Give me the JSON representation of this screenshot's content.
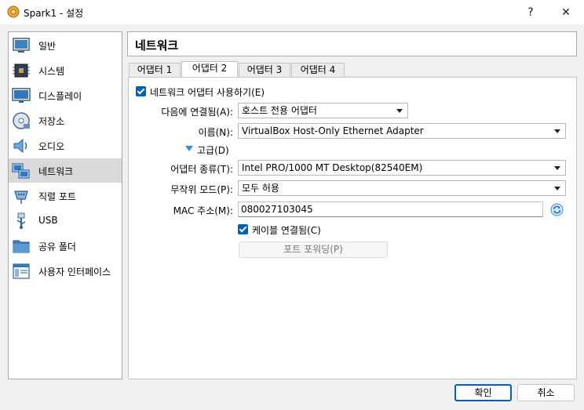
{
  "window": {
    "title": "Spark1 - 설정",
    "help_glyph": "?",
    "close_glyph": "✕"
  },
  "sidebar": {
    "items": [
      {
        "label": "일반",
        "icon": "general-icon"
      },
      {
        "label": "시스템",
        "icon": "system-icon"
      },
      {
        "label": "디스플레이",
        "icon": "display-icon"
      },
      {
        "label": "저장소",
        "icon": "storage-icon"
      },
      {
        "label": "오디오",
        "icon": "audio-icon"
      },
      {
        "label": "네트워크",
        "icon": "network-icon",
        "selected": true
      },
      {
        "label": "직렬 포트",
        "icon": "serial-port-icon"
      },
      {
        "label": "USB",
        "icon": "usb-icon"
      },
      {
        "label": "공유 폴더",
        "icon": "shared-folder-icon"
      },
      {
        "label": "사용자 인터페이스",
        "icon": "user-interface-icon"
      }
    ]
  },
  "page": {
    "title": "네트워크"
  },
  "tabs": [
    {
      "label": "어댑터 1"
    },
    {
      "label": "어댑터 2",
      "active": true
    },
    {
      "label": "어댑터 3"
    },
    {
      "label": "어댑터 4"
    }
  ],
  "adapter": {
    "enable_label": "네트워크 어댑터 사용하기(E)",
    "attached_label": "다음에 연결됨(A):",
    "attached_value": "호스트 전용 어댑터",
    "name_label": "이름(N):",
    "name_value": "VirtualBox Host-Only Ethernet Adapter",
    "advanced_label": "고급(D)",
    "type_label": "어댑터 종류(T):",
    "type_value": "Intel PRO/1000 MT Desktop(82540EM)",
    "promisc_label": "무작위 모드(P):",
    "promisc_value": "모두 허용",
    "mac_label": "MAC 주소(M):",
    "mac_value": "080027103045",
    "cable_label": "케이블 연결됨(C)",
    "port_forwarding_label": "포트 포워딩(P)"
  },
  "buttons": {
    "ok": "확인",
    "cancel": "취소"
  },
  "colors": {
    "accent": "#005fb8",
    "selected_bg": "#d9d9d9"
  }
}
